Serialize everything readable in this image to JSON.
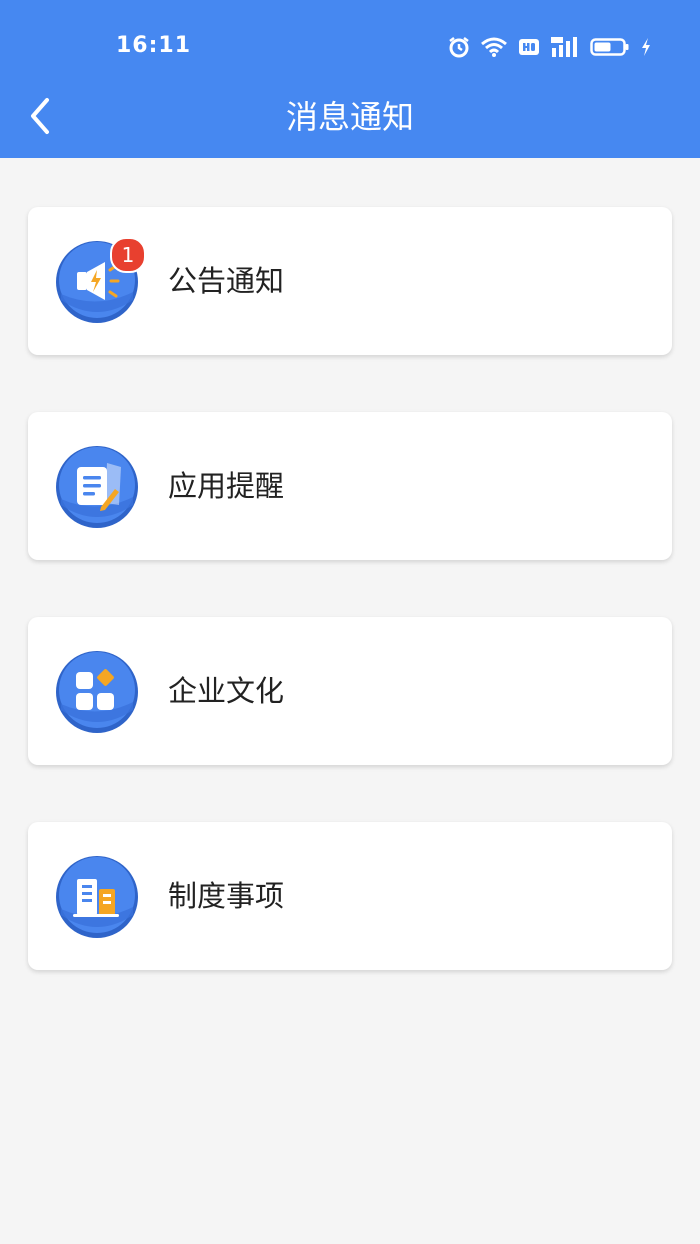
{
  "status_bar": {
    "time": "16:11",
    "icons": [
      "alarm-icon",
      "wifi-icon",
      "hd-icon",
      "signal-5g-icon",
      "battery-icon",
      "charging-icon"
    ]
  },
  "nav": {
    "back_icon": "chevron-left-icon",
    "title": "消息通知"
  },
  "items": [
    {
      "label": "公告通知",
      "icon": "megaphone-icon",
      "badge": "1"
    },
    {
      "label": "应用提醒",
      "icon": "document-pen-icon",
      "badge": null
    },
    {
      "label": "企业文化",
      "icon": "grid-tiles-icon",
      "badge": null
    },
    {
      "label": "制度事项",
      "icon": "building-icon",
      "badge": null
    }
  ],
  "colors": {
    "header_bg": "#4688f1",
    "page_bg": "#f5f5f5",
    "icon_blue": "#3b78e7",
    "icon_accent": "#f5a623",
    "badge_red": "#e8402f"
  }
}
